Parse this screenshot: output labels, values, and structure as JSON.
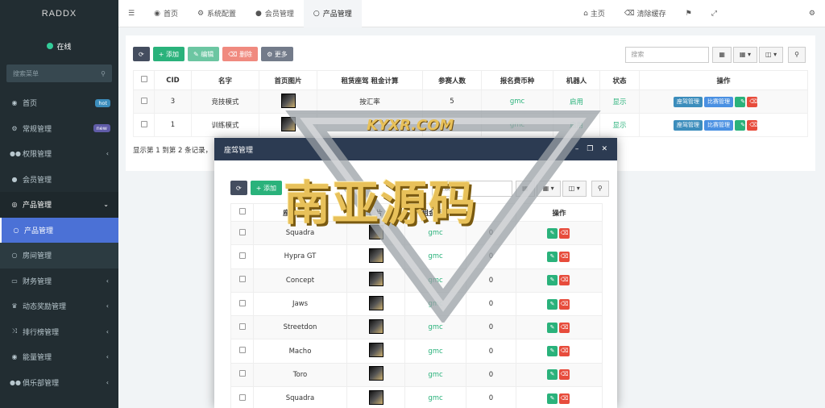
{
  "app": {
    "logo": "RADDX",
    "status": "在线",
    "search_placeholder": "搜索菜单"
  },
  "sidebar": {
    "items": [
      {
        "label": "首页",
        "icon": "dashboard-icon",
        "badge": "hot",
        "badge_color": "#3c8dbc"
      },
      {
        "label": "常规管理",
        "icon": "cogs-icon",
        "badge": "new",
        "badge_color": "#605ca8"
      },
      {
        "label": "权限管理",
        "icon": "users-icon",
        "caret": "‹"
      },
      {
        "label": "会员管理",
        "icon": "user-icon"
      },
      {
        "label": "产品管理",
        "icon": "product-icon",
        "caret": "⌄"
      },
      {
        "label": "产品管理",
        "icon": "circle-icon"
      },
      {
        "label": "房间管理",
        "icon": "circle-icon"
      },
      {
        "label": "财务管理",
        "icon": "card-icon",
        "caret": "‹"
      },
      {
        "label": "动态奖励管理",
        "icon": "trophy-icon",
        "caret": "‹"
      },
      {
        "label": "排行榜管理",
        "icon": "random-icon",
        "caret": "‹"
      },
      {
        "label": "能量管理",
        "icon": "energy-icon",
        "caret": "‹"
      },
      {
        "label": "俱乐部管理",
        "icon": "club-icon",
        "caret": "‹"
      }
    ]
  },
  "topbar": {
    "tabs": [
      {
        "label": "首页",
        "icon": "dashboard-icon"
      },
      {
        "label": "系统配置",
        "icon": "cog-icon"
      },
      {
        "label": "会员管理",
        "icon": "user-icon"
      },
      {
        "label": "产品管理",
        "icon": "circle-icon"
      }
    ],
    "right": [
      {
        "label": "主页",
        "icon": "home-icon"
      },
      {
        "label": "清除缓存",
        "icon": "trash-icon"
      },
      {
        "label": "",
        "icon": "flag-icon"
      },
      {
        "label": "",
        "icon": "fullscreen-icon"
      }
    ]
  },
  "toolbar": {
    "add": "添加",
    "edit": "编辑",
    "delete": "删除",
    "more": "更多",
    "search_placeholder": "搜索"
  },
  "table": {
    "headers": [
      "CID",
      "名字",
      "首页图片",
      "租赁座驾 租金计算",
      "参赛人数",
      "报名费币种",
      "机器人",
      "状态",
      "操作"
    ],
    "rows": [
      {
        "cid": "3",
        "name": "竞技模式",
        "calc": "按汇率",
        "count": "5",
        "currency": "gmc",
        "robot": "启用",
        "status": "显示"
      },
      {
        "cid": "1",
        "name": "训练模式",
        "calc": "",
        "count": "",
        "currency": "gmc",
        "robot": "启用",
        "status": "显示"
      }
    ],
    "action_car": "座驾管理",
    "action_race": "比赛管理",
    "info": "显示第 1 到第 2 条记录，"
  },
  "modal": {
    "title": "座驾管理",
    "add": "添加",
    "search_placeholder": "搜索",
    "headers": [
      "座驾名中文",
      "图片",
      "租金币种",
      "",
      "操作"
    ],
    "rows": [
      {
        "name": "Squadra",
        "currency": "gmc",
        "count": "0"
      },
      {
        "name": "Hypra GT",
        "currency": "gmc",
        "count": "0"
      },
      {
        "name": "Concept",
        "currency": "gmc",
        "count": "0"
      },
      {
        "name": "Jaws",
        "currency": "gmc",
        "count": "0"
      },
      {
        "name": "Streetdon",
        "currency": "gmc",
        "count": "0"
      },
      {
        "name": "Macho",
        "currency": "gmc",
        "count": "0"
      },
      {
        "name": "Toro",
        "currency": "gmc",
        "count": "0"
      },
      {
        "name": "Squadra",
        "currency": "gmc",
        "count": "0"
      }
    ]
  },
  "watermark": {
    "top": "KYXR.COM",
    "main": "南亚源码"
  }
}
